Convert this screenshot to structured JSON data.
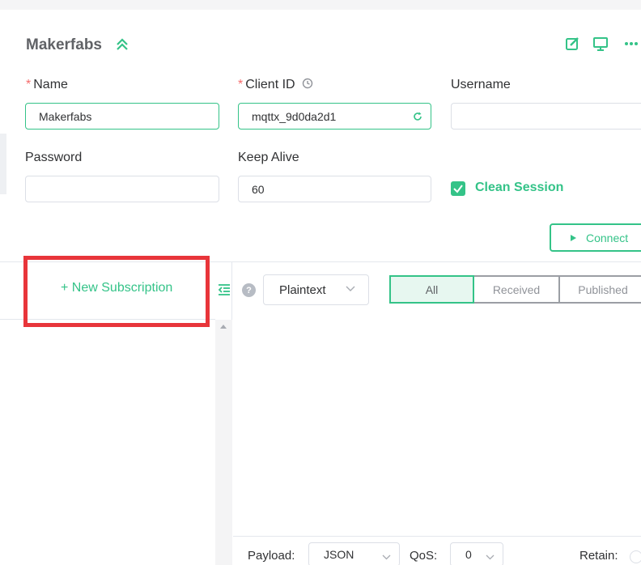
{
  "connection": {
    "title": "Makerfabs",
    "fields": {
      "name": {
        "label": "Name",
        "value": "Makerfabs",
        "required": "*"
      },
      "client_id": {
        "label": "Client ID",
        "value": "mqttx_9d0da2d1",
        "required": "*"
      },
      "username": {
        "label": "Username",
        "value": ""
      },
      "password": {
        "label": "Password",
        "value": ""
      },
      "keep_alive": {
        "label": "Keep Alive",
        "value": "60"
      }
    },
    "clean_session": {
      "label": "Clean Session",
      "checked": true
    },
    "connect_label": "Connect"
  },
  "subscriptions": {
    "new_label": "+ New Subscription"
  },
  "messages": {
    "help": "?",
    "format": "Plaintext",
    "filters": [
      "All",
      "Received",
      "Published"
    ],
    "selected_filter": "All"
  },
  "publish": {
    "payload_label": "Payload:",
    "payload_format": "JSON",
    "qos_label": "QoS:",
    "qos_value": "0",
    "retain_label": "Retain:"
  },
  "colors": {
    "accent": "#34c388",
    "highlight": "#e8353a"
  }
}
